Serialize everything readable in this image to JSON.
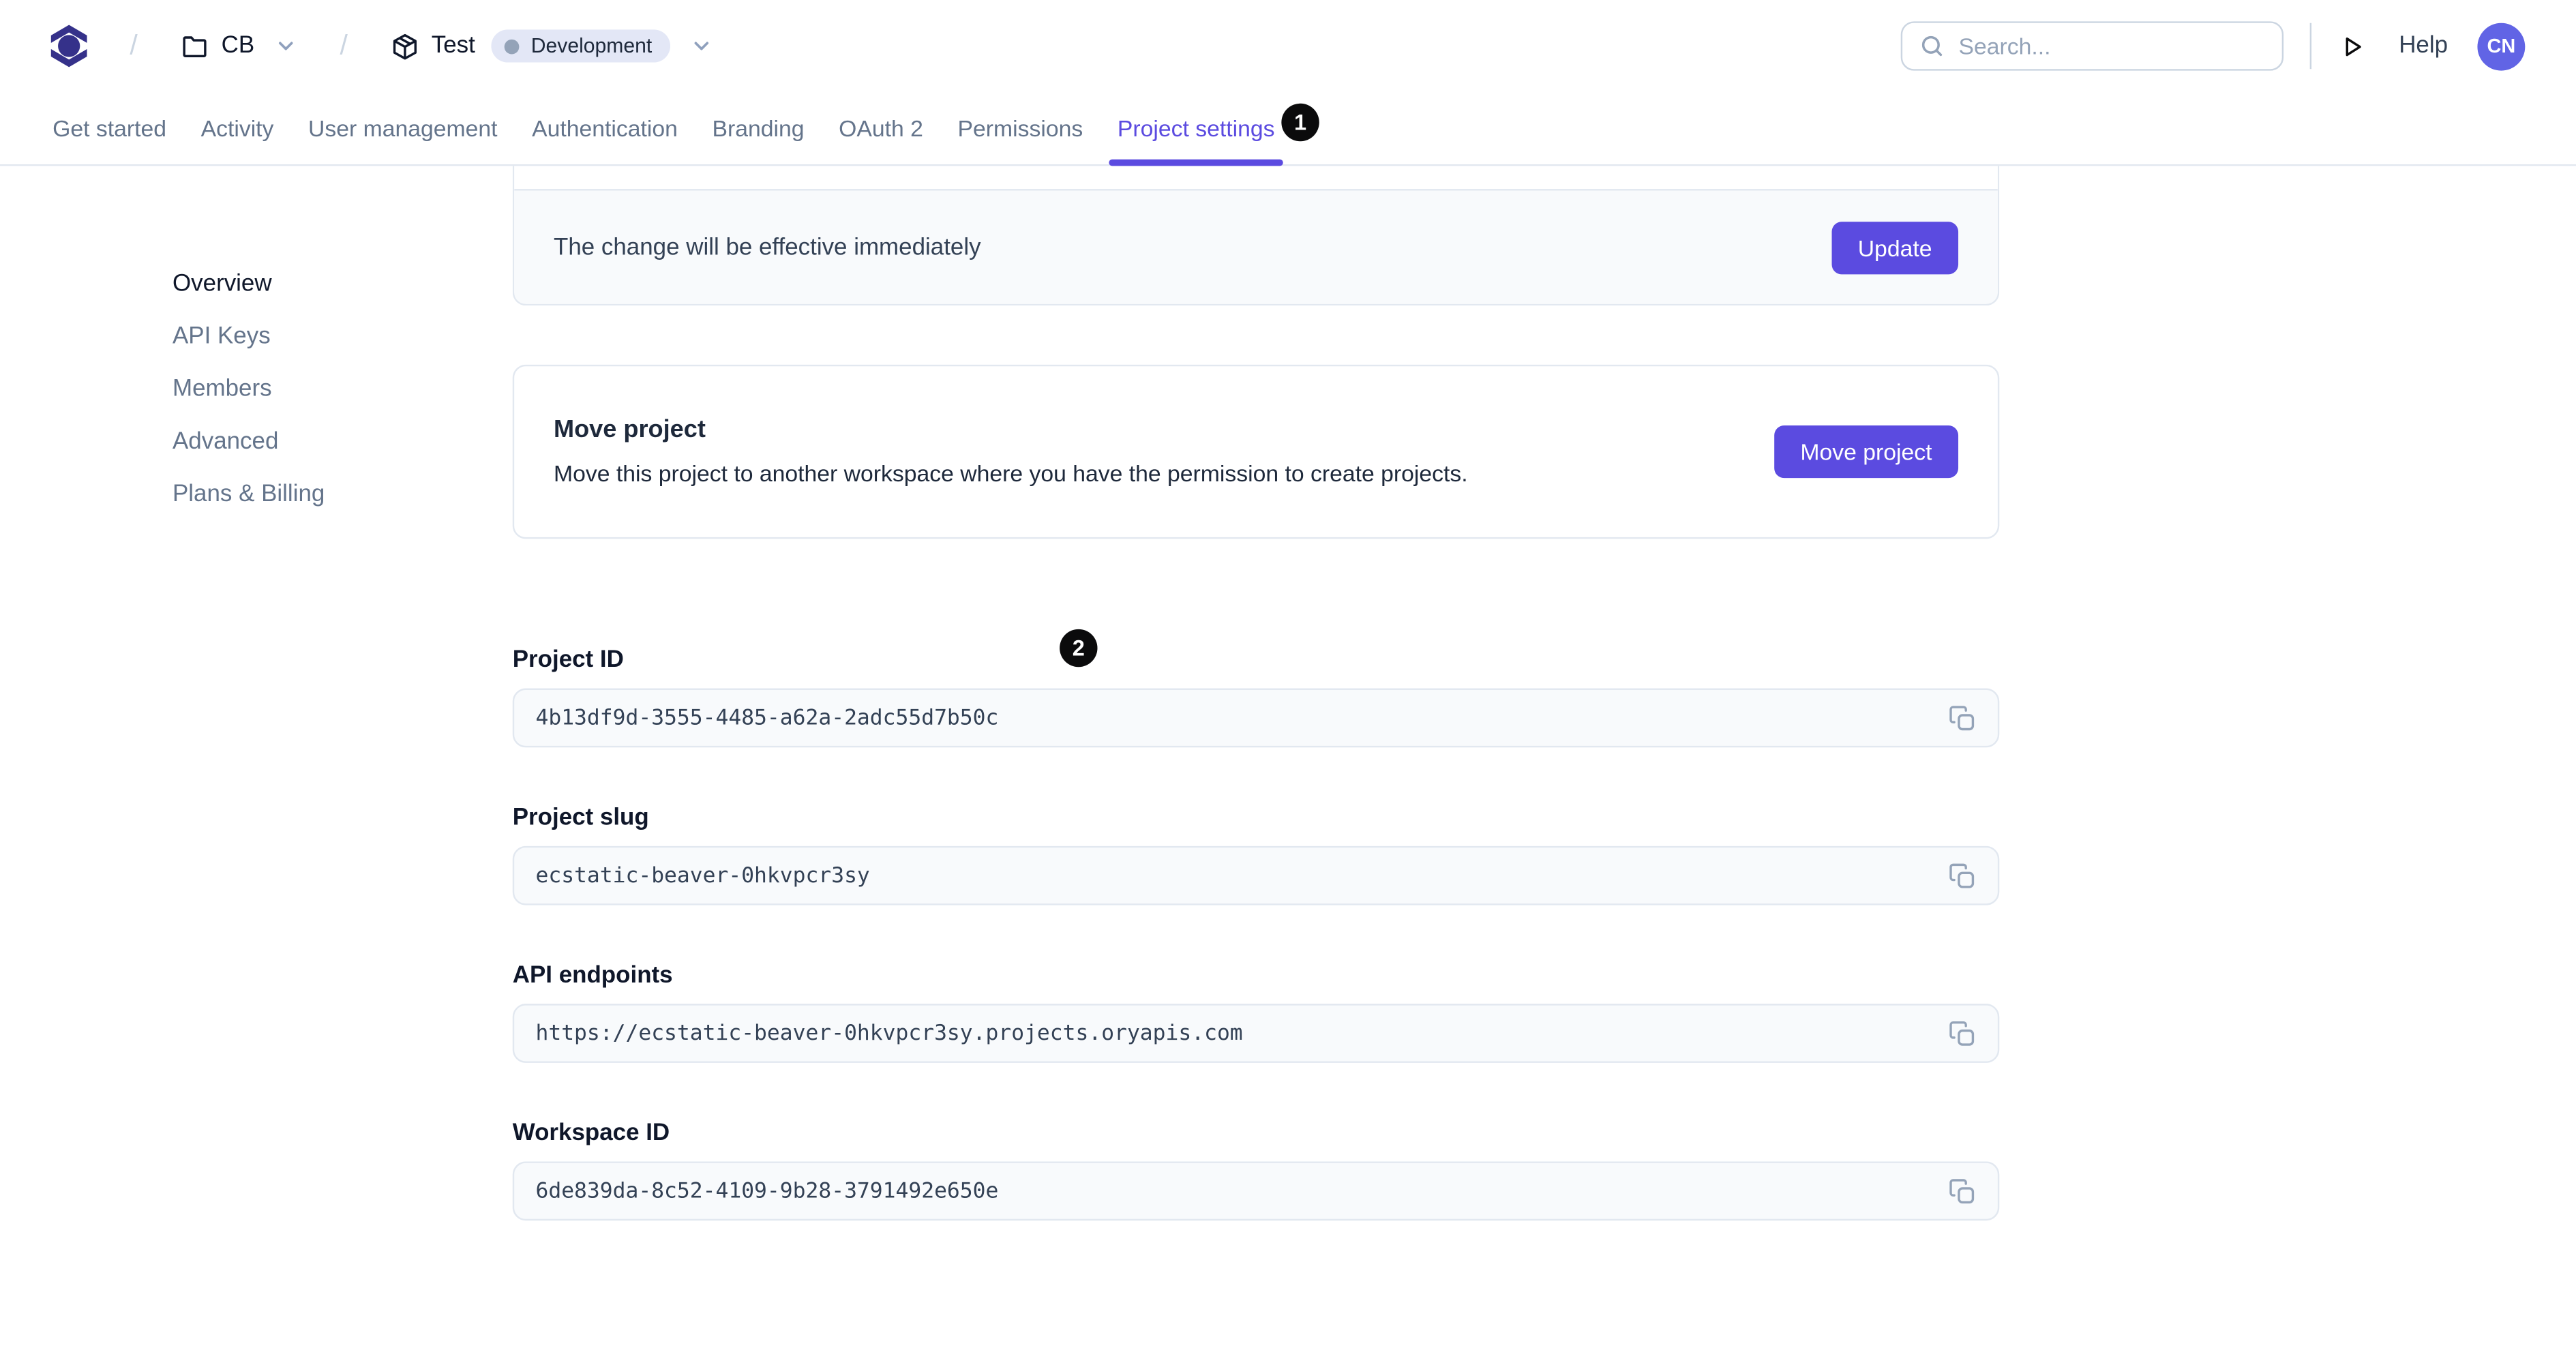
{
  "colors": {
    "accent": "#5b4be0",
    "logo": "#35318a",
    "badge_background": "#e3e7f6",
    "badge_dot": "#94a3b8",
    "field_background": "#f8fafc",
    "border": "#e2e8f0",
    "marker_background": "#0b0b0c",
    "avatar_background": "#6164e5"
  },
  "header": {
    "breadcrumb_separator": "/",
    "workspace_label": "CB",
    "project_label": "Test",
    "environment_badge": "Development",
    "search_placeholder": "Search...",
    "help_label": "Help",
    "avatar_initials": "CN"
  },
  "tabs": [
    {
      "label": "Get started"
    },
    {
      "label": "Activity"
    },
    {
      "label": "User management"
    },
    {
      "label": "Authentication"
    },
    {
      "label": "Branding"
    },
    {
      "label": "OAuth 2"
    },
    {
      "label": "Permissions"
    },
    {
      "label": "Project settings",
      "active": true
    }
  ],
  "annotations": {
    "marker1": "1",
    "marker2": "2"
  },
  "sidebar": [
    {
      "label": "Overview",
      "active": true
    },
    {
      "label": "API Keys"
    },
    {
      "label": "Members"
    },
    {
      "label": "Advanced"
    },
    {
      "label": "Plans & Billing"
    }
  ],
  "content": {
    "update_card": {
      "note": "The change will be effective immediately",
      "button_label": "Update"
    },
    "move_card": {
      "title": "Move project",
      "description": "Move this project to another workspace where you have the permission to create projects.",
      "button_label": "Move project"
    },
    "fields": [
      {
        "label": "Project ID",
        "value": "4b13df9d-3555-4485-a62a-2adc55d7b50c"
      },
      {
        "label": "Project slug",
        "value": "ecstatic-beaver-0hkvpcr3sy"
      },
      {
        "label": "API endpoints",
        "value": "https://ecstatic-beaver-0hkvpcr3sy.projects.oryapis.com"
      },
      {
        "label": "Workspace ID",
        "value": "6de839da-8c52-4109-9b28-3791492e650e"
      }
    ]
  }
}
